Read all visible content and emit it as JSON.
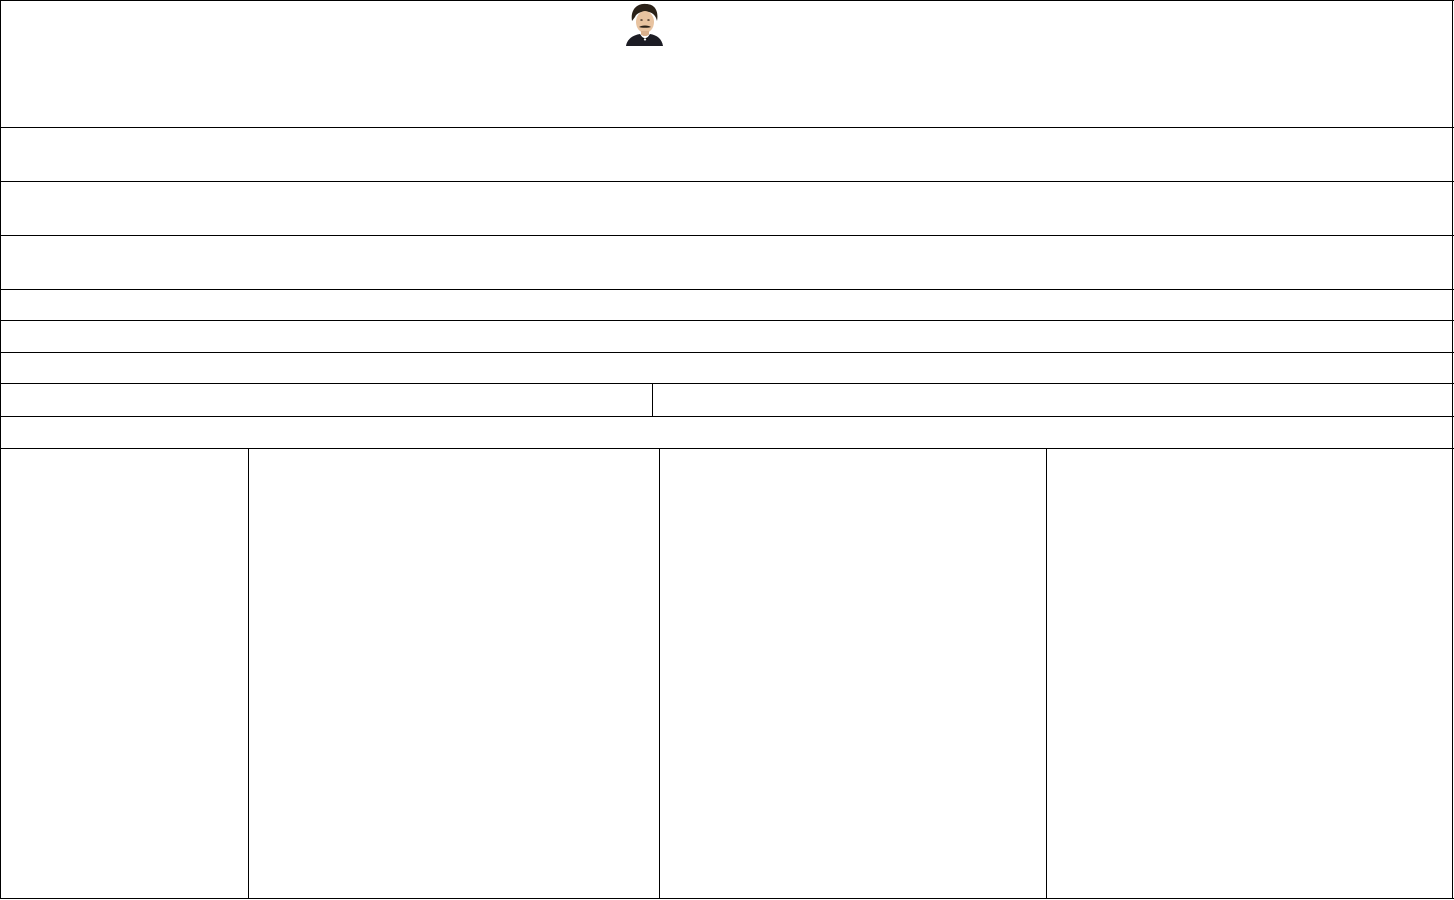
{
  "header": {
    "portrait_alt": "",
    "text": ""
  },
  "rows": [
    {
      "text": ""
    },
    {
      "text": ""
    },
    {
      "text": ""
    },
    {
      "text": ""
    },
    {
      "text": ""
    },
    {
      "text": ""
    }
  ],
  "split_row": {
    "left": "",
    "right": ""
  },
  "wide_row": {
    "text": ""
  },
  "columns": [
    {
      "text": ""
    },
    {
      "text": ""
    },
    {
      "text": ""
    },
    {
      "text": ""
    }
  ],
  "colors": {
    "line": "#000000",
    "background": "#ffffff"
  }
}
